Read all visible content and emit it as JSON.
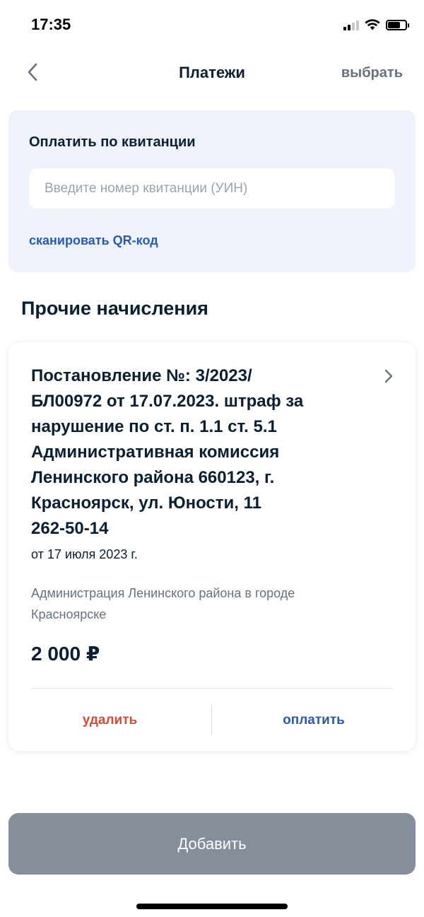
{
  "status_bar": {
    "time": "17:35",
    "icons": [
      "cellular-signal-icon",
      "wifi-icon",
      "battery-icon"
    ]
  },
  "nav": {
    "back_icon": "chevron-left-icon",
    "title": "Платежи",
    "action_label": "выбрать"
  },
  "receipt": {
    "title": "Оплатить по квитанции",
    "input_value": "",
    "input_placeholder": "Введите номер квитанции (УИН)",
    "scan_label": "сканировать QR-код"
  },
  "section": {
    "title": "Прочие начисления"
  },
  "charges": [
    {
      "title_lines": [
        "Постановление №: 3/2023/",
        "БЛ00972 от 17.07.2023. штраф за",
        "нарушение по ст. п. 1.1 ст. 5.1",
        "Административная комиссия",
        "Ленинского района 660123, г.",
        "Красноярск, ул. Юности, 11",
        "262-50-14"
      ],
      "date": "от 17 июля 2023 г.",
      "organization_lines": [
        "Администрация Ленинского района в городе",
        "Красноярске"
      ],
      "amount": "2 000 ₽",
      "delete_label": "удалить",
      "pay_label": "оплатить",
      "chevron_icon": "chevron-right-icon"
    }
  ],
  "footer": {
    "add_label": "Добавить"
  },
  "colors": {
    "accent_blue": "#2b5aae",
    "danger_red": "#d64a3a",
    "panel_bg": "#eef3fb",
    "button_disabled": "#868e9c",
    "text_primary": "#0b1f33",
    "text_secondary": "#66727f"
  }
}
